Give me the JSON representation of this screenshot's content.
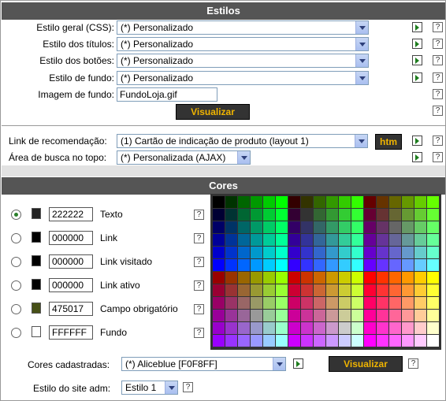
{
  "estilos": {
    "header": "Estilos",
    "rows": [
      {
        "label": "Estilo geral (CSS):",
        "value": "(*) Personalizado"
      },
      {
        "label": "Estilo dos títulos:",
        "value": "(*) Personalizado"
      },
      {
        "label": "Estilo dos botões:",
        "value": "(*) Personalizado"
      },
      {
        "label": "Estilo de fundo:",
        "value": "(*) Personalizado"
      }
    ],
    "image_label": "Imagem de fundo:",
    "image_value": "FundoLoja.gif",
    "visualizar_label": "Visualizar",
    "link_label": "Link de recomendação:",
    "link_value": "(1) Cartão de indicação de produto (layout 1)",
    "htm_label": "htm",
    "busca_label": "Área de busca no topo:",
    "busca_value": "(*) Personalizada (AJAX)",
    "help_glyph": "?"
  },
  "cores": {
    "header": "Cores",
    "items": [
      {
        "hex": "222222",
        "label": "Texto",
        "color": "#222222",
        "selected": true
      },
      {
        "hex": "000000",
        "label": "Link",
        "color": "#000000",
        "selected": false
      },
      {
        "hex": "000000",
        "label": "Link visitado",
        "color": "#000000",
        "selected": false
      },
      {
        "hex": "000000",
        "label": "Link ativo",
        "color": "#000000",
        "selected": false
      },
      {
        "hex": "475017",
        "label": "Campo obrigatório",
        "color": "#475017",
        "selected": false
      },
      {
        "hex": "FFFFFF",
        "label": "Fundo",
        "color": "#FFFFFF",
        "selected": false
      }
    ],
    "cadastradas_label": "Cores cadastradas:",
    "cadastradas_value": "(*) Aliceblue [F0F8FF]",
    "visualizar_label": "Visualizar",
    "adm_label": "Estilo do site adm:",
    "adm_value": "Estilo 1"
  },
  "colors": {
    "header_bg": "#555555",
    "button_bg": "#333333",
    "button_text": "#F0B400",
    "panel_bg": "#E2E2E2"
  }
}
